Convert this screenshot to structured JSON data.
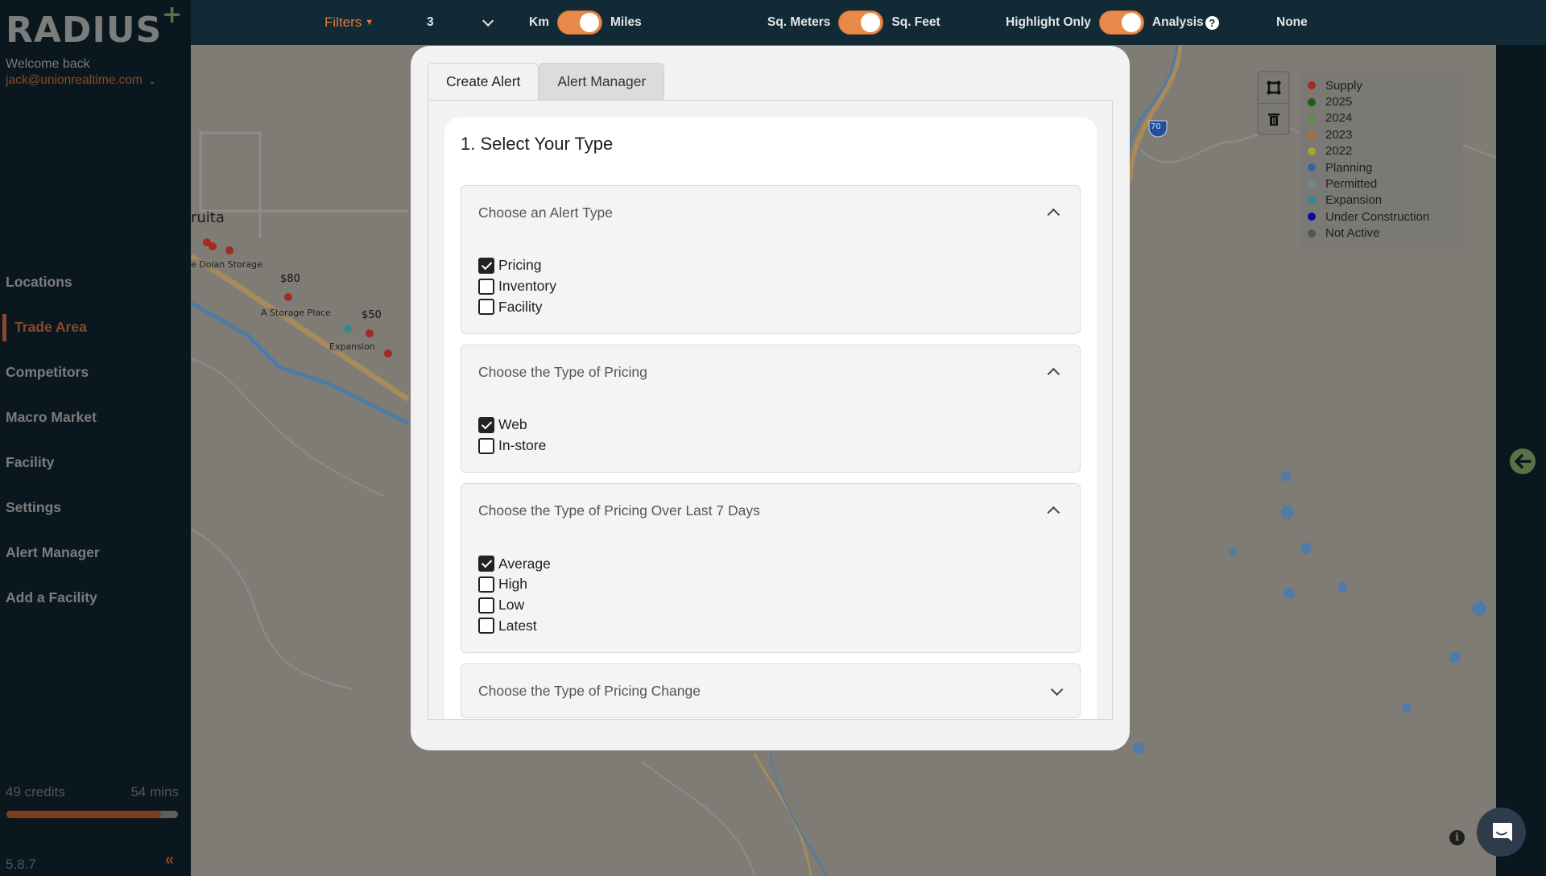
{
  "sidebar": {
    "logo": "RADIUS",
    "logo_plus": "+",
    "welcome": "Welcome back",
    "user_email": "jack@unionrealtime.com",
    "nav": [
      {
        "label": "Locations",
        "active": false
      },
      {
        "label": "Trade Area",
        "active": true
      },
      {
        "label": "Competitors",
        "active": false
      },
      {
        "label": "Macro Market",
        "active": false
      },
      {
        "label": "Facility",
        "active": false
      },
      {
        "label": "Settings",
        "active": false
      },
      {
        "label": "Alert Manager",
        "active": false
      },
      {
        "label": "Add a Facility",
        "active": false
      }
    ],
    "credits": "49 credits",
    "time_left": "54 mins",
    "credits_progress_percent": 90,
    "version": "5.8.7",
    "collapse_icon": "«"
  },
  "topbar": {
    "filters_label": "Filters",
    "radius_value": "3",
    "units_left": "Km",
    "units_right": "Miles",
    "area_left": "Sq. Meters",
    "area_right": "Sq. Feet",
    "highlight_left": "Highlight Only",
    "highlight_right": "Analysis",
    "help_icon": "?",
    "analysis_select": "None",
    "toggles": {
      "units_miles": true,
      "area_sqfeet": true,
      "analysis": true
    }
  },
  "map": {
    "town": "ruita",
    "labels": [
      "e Dolan Storage",
      "A Storage Place",
      "Expansion"
    ],
    "prices": [
      "$80",
      "$50"
    ],
    "highway_shield": "70",
    "info_icon": "i",
    "legend": [
      {
        "label": "Supply",
        "color": "#a52a22"
      },
      {
        "label": "2025",
        "color": "#1f5a1b"
      },
      {
        "label": "2024",
        "color": "#5e8a52"
      },
      {
        "label": "2023",
        "color": "#a87530"
      },
      {
        "label": "2022",
        "color": "#a8a436"
      },
      {
        "label": "Planning",
        "color": "#3565a8"
      },
      {
        "label": "Permitted",
        "color": "#6b8890"
      },
      {
        "label": "Expansion",
        "color": "#2f8a8a"
      },
      {
        "label": "Under Construction",
        "color": "#0a0aa0"
      },
      {
        "label": "Not Active",
        "color": "#555555"
      }
    ]
  },
  "modal": {
    "tabs": [
      {
        "label": "Create Alert",
        "active": true
      },
      {
        "label": "Alert Manager",
        "active": false
      }
    ],
    "step_title": "1. Select Your Type",
    "sections": [
      {
        "title": "Choose an Alert Type",
        "expanded": true,
        "options": [
          {
            "label": "Pricing",
            "checked": true
          },
          {
            "label": "Inventory",
            "checked": false
          },
          {
            "label": "Facility",
            "checked": false
          }
        ]
      },
      {
        "title": "Choose the Type of Pricing",
        "expanded": true,
        "options": [
          {
            "label": "Web",
            "checked": true
          },
          {
            "label": "In-store",
            "checked": false
          }
        ]
      },
      {
        "title": "Choose the Type of Pricing Over Last 7 Days",
        "expanded": true,
        "options": [
          {
            "label": "Average",
            "checked": true
          },
          {
            "label": "High",
            "checked": false
          },
          {
            "label": "Low",
            "checked": false
          },
          {
            "label": "Latest",
            "checked": false
          }
        ]
      },
      {
        "title": "Choose the Type of Pricing Change",
        "expanded": false,
        "options": []
      }
    ]
  }
}
